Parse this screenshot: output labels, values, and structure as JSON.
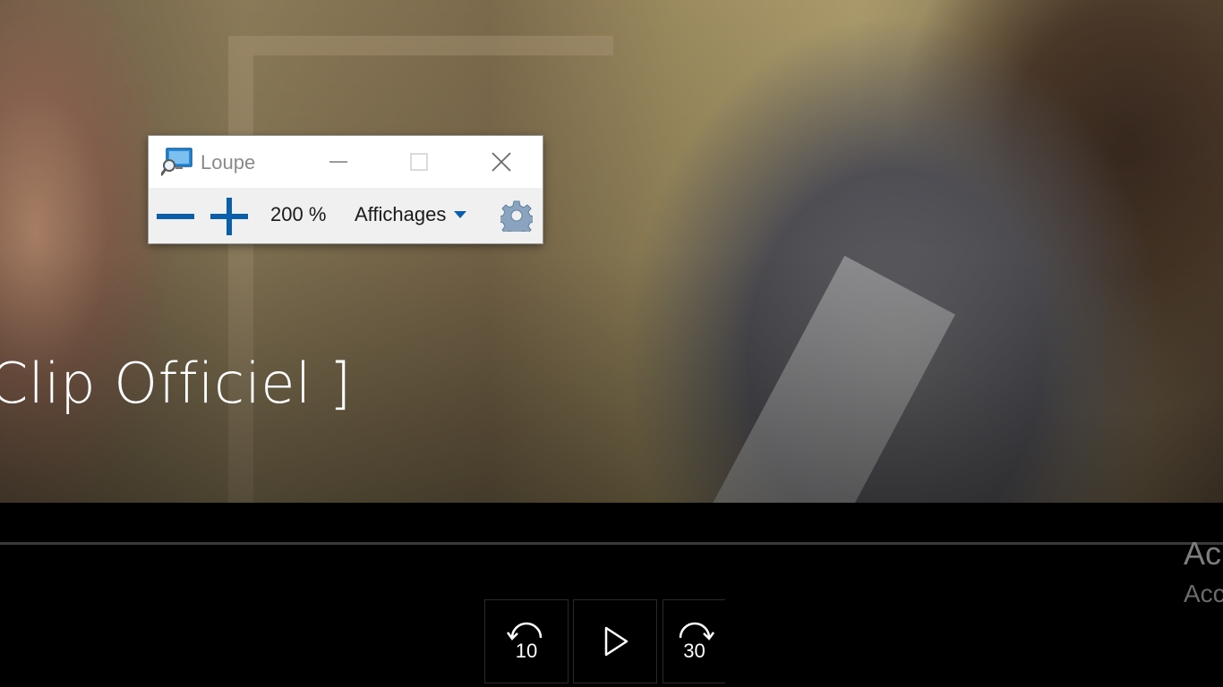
{
  "video": {
    "title": "Clip Officiel ]"
  },
  "player": {
    "side_title": "Ac",
    "side_subtitle": "Acc",
    "rewind_seconds": "10",
    "forward_seconds": "30",
    "icons": {
      "rewind": "rewind-10-icon",
      "play": "play-icon",
      "forward": "forward-30-icon"
    }
  },
  "magnifier": {
    "title": "Loupe",
    "zoom_level": "200 %",
    "views_label": "Affichages",
    "icons": {
      "app": "magnifier-app-icon",
      "minimize": "minimize-icon",
      "maximize": "maximize-icon",
      "close": "close-icon",
      "zoom_out": "minus-icon",
      "zoom_in": "plus-icon",
      "dropdown": "caret-down-icon",
      "settings": "gear-icon"
    },
    "colors": {
      "accent": "#0a5fad",
      "titlebar": "#ffffff",
      "toolbar": "#f0f0f0"
    }
  }
}
